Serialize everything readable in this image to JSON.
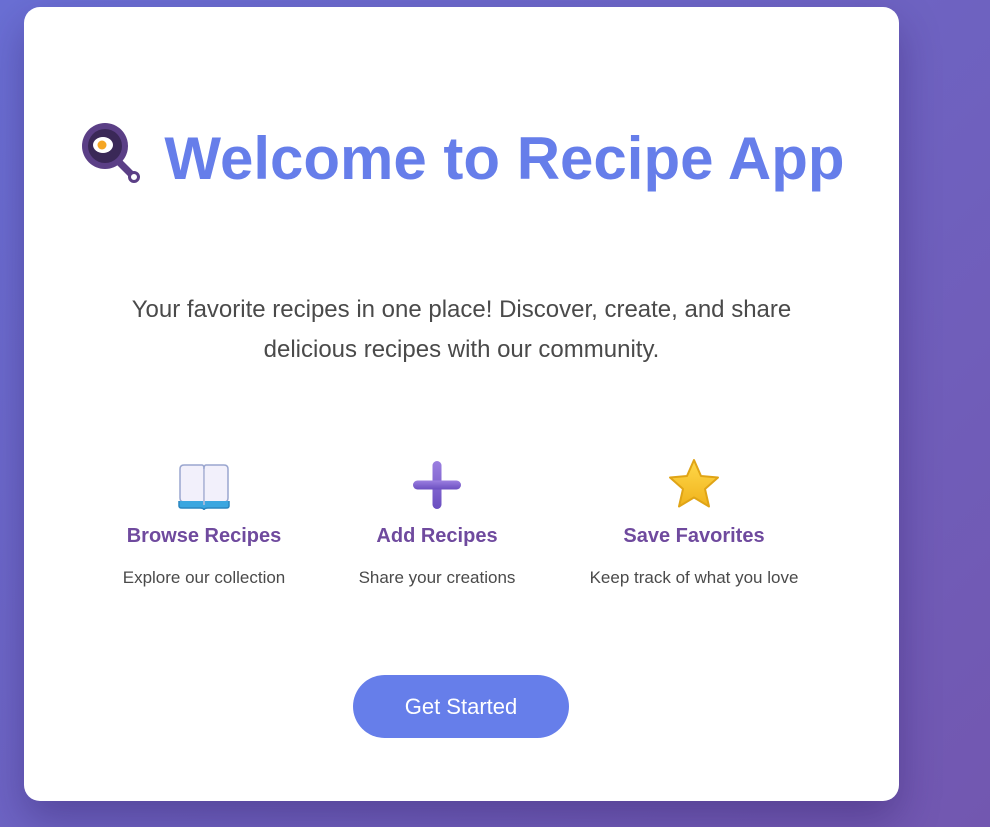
{
  "hero": {
    "icon": "frying-pan-egg-icon",
    "title": "Welcome to Recipe App",
    "subtitle": "Your favorite recipes in one place! Discover, create, and share delicious recipes with our community."
  },
  "features": [
    {
      "icon": "open-book-icon",
      "title": "Browse Recipes",
      "description": "Explore our collection"
    },
    {
      "icon": "plus-icon",
      "title": "Add Recipes",
      "description": "Share your creations"
    },
    {
      "icon": "star-icon",
      "title": "Save Favorites",
      "description": "Keep track of what you love"
    }
  ],
  "cta": {
    "label": "Get Started"
  },
  "colors": {
    "accent": "#667eea",
    "feature_heading": "#6f4a9e",
    "text": "#4a4a4a",
    "background_start": "#6a6fd4",
    "background_end": "#7257b0"
  }
}
